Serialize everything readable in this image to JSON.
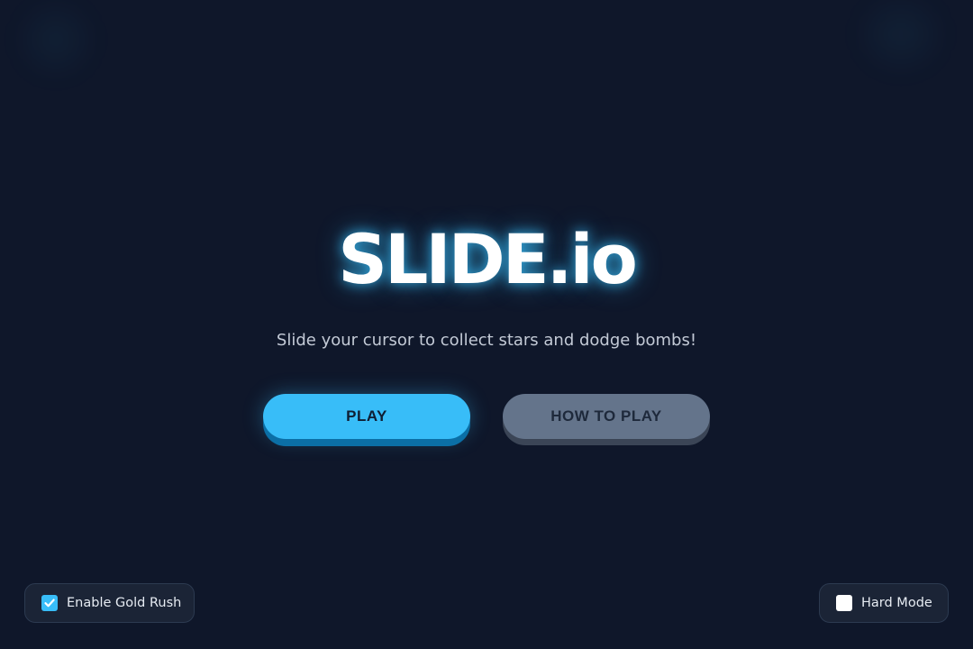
{
  "title": "SLIDE.io",
  "subtitle": "Slide your cursor to collect stars and dodge bombs!",
  "buttons": {
    "play": "PLAY",
    "how_to_play": "HOW TO PLAY"
  },
  "options": {
    "gold_rush": {
      "label": "Enable Gold Rush",
      "checked": true
    },
    "hard_mode": {
      "label": "Hard Mode",
      "checked": false
    }
  },
  "colors": {
    "background": "#0f172a",
    "accent": "#38bdf8",
    "secondary_button": "#64748b"
  },
  "icons": {
    "checkbox_checked": "checkmark-icon"
  }
}
